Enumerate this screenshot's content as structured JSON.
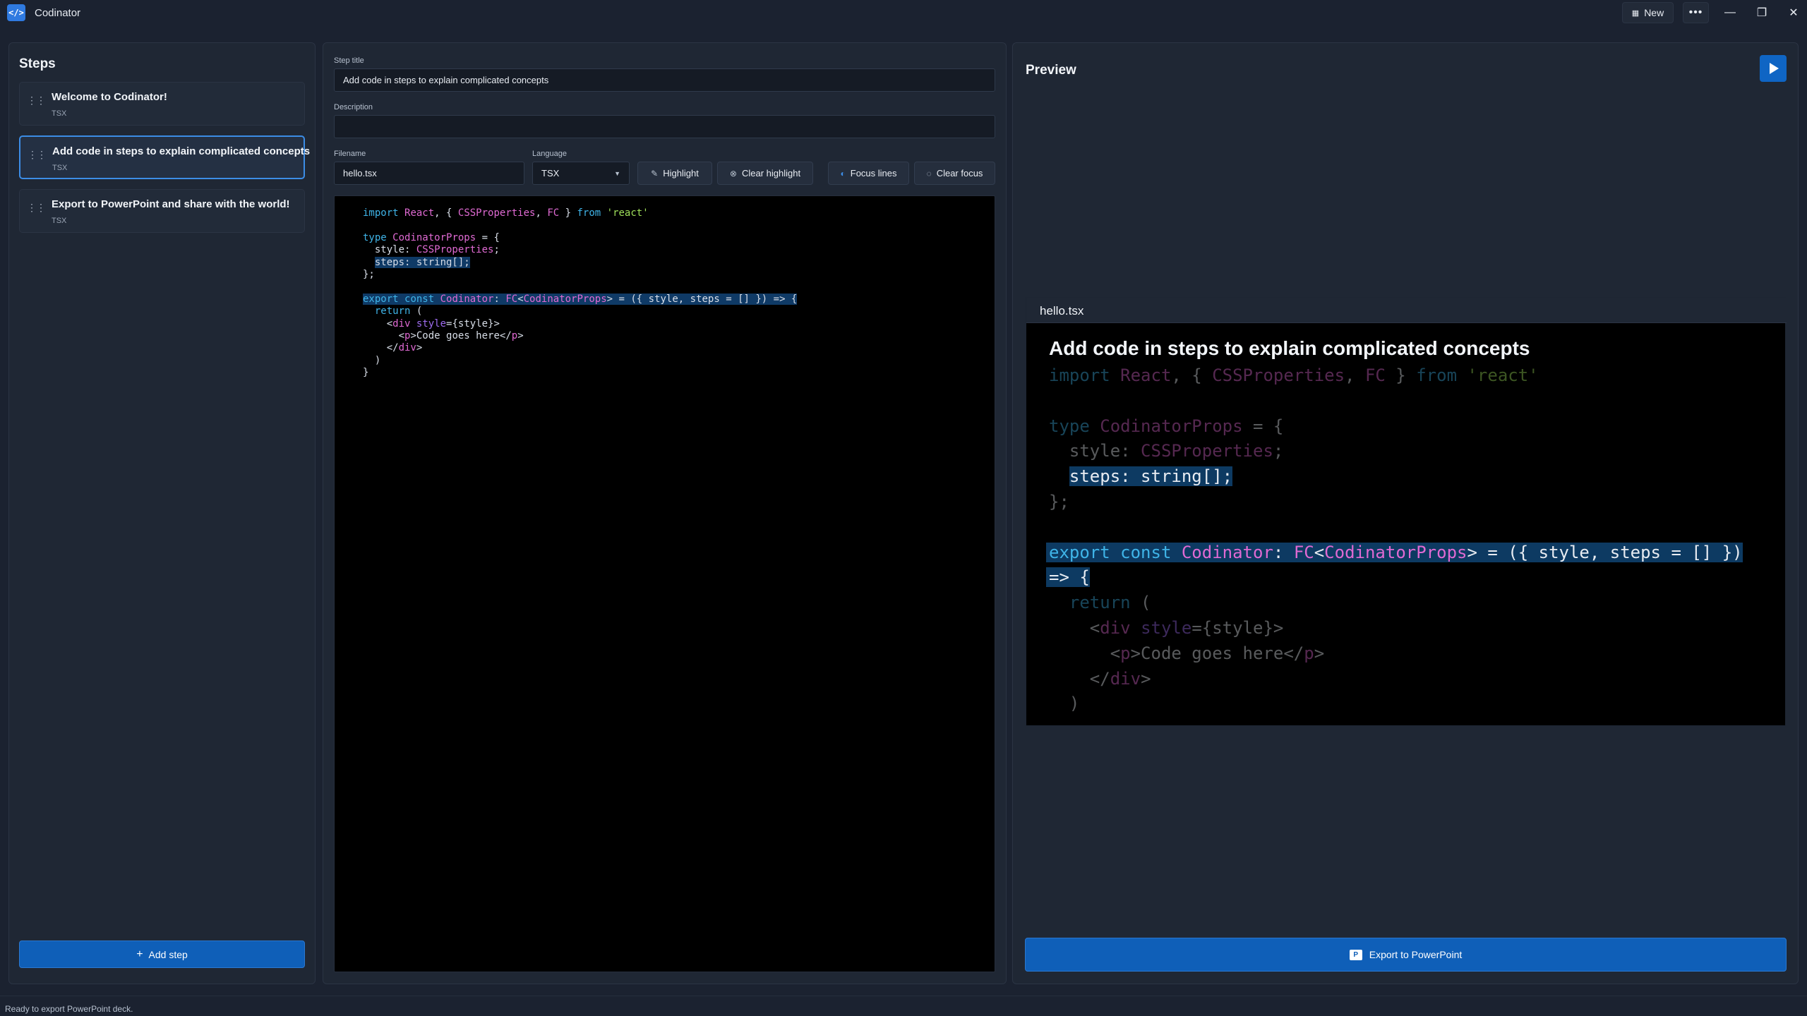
{
  "app": {
    "title": "Codinator",
    "icon_glyph": "</>",
    "new_label": "New",
    "more_glyph": "•••"
  },
  "window_controls": {
    "minimize": "—",
    "restore": "❐",
    "close": "✕"
  },
  "steps": {
    "heading": "Steps",
    "items": [
      {
        "title": "Welcome to Codinator!",
        "lang": "TSX",
        "active": false
      },
      {
        "title": "Add code in steps to explain complicated concepts",
        "lang": "TSX",
        "active": true
      },
      {
        "title": "Export to PowerPoint and share with the world!",
        "lang": "TSX",
        "active": false
      }
    ],
    "add_label": "Add step"
  },
  "editor": {
    "step_title_label": "Step title",
    "step_title_value": "Add code in steps to explain complicated concepts",
    "description_label": "Description",
    "description_value": "",
    "filename_label": "Filename",
    "filename_value": "hello.tsx",
    "language_label": "Language",
    "language_value": "TSX",
    "buttons": {
      "highlight": "Highlight",
      "clear_highlight": "Clear highlight",
      "focus_lines": "Focus lines",
      "clear_focus": "Clear focus"
    }
  },
  "preview": {
    "heading": "Preview",
    "file_tab": "hello.tsx",
    "slide_title": "Add code in steps to explain complicated concepts",
    "export_label": "Export to PowerPoint"
  },
  "status": {
    "text": "Ready to export PowerPoint deck."
  },
  "colors": {
    "accent": "#0f5fb8",
    "keyword": "#3fb4e8",
    "type": "#e06ad3",
    "string": "#9fe05a",
    "highlight": "#0f3a66"
  }
}
